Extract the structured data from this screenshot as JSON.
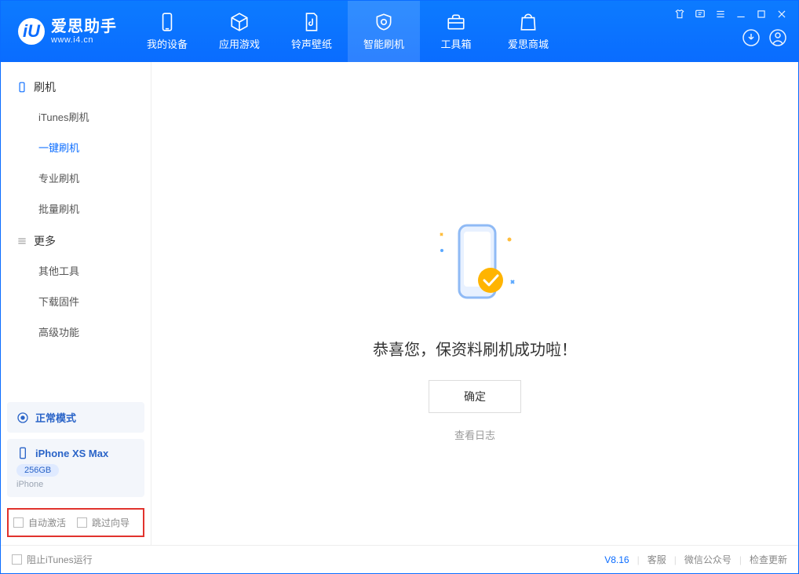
{
  "brand": {
    "title": "爱思助手",
    "subtitle": "www.i4.cn"
  },
  "tabs": [
    {
      "label": "我的设备"
    },
    {
      "label": "应用游戏"
    },
    {
      "label": "铃声壁纸"
    },
    {
      "label": "智能刷机"
    },
    {
      "label": "工具箱"
    },
    {
      "label": "爱思商城"
    }
  ],
  "sidebar": {
    "group1": {
      "title": "刷机",
      "items": [
        {
          "label": "iTunes刷机"
        },
        {
          "label": "一键刷机"
        },
        {
          "label": "专业刷机"
        },
        {
          "label": "批量刷机"
        }
      ]
    },
    "group2": {
      "title": "更多",
      "items": [
        {
          "label": "其他工具"
        },
        {
          "label": "下载固件"
        },
        {
          "label": "高级功能"
        }
      ]
    },
    "mode_box": {
      "label": "正常模式"
    },
    "device_box": {
      "name": "iPhone XS Max",
      "storage": "256GB",
      "type": "iPhone"
    },
    "checks": {
      "auto_activate": "自动激活",
      "skip_guide": "跳过向导"
    }
  },
  "main": {
    "success_message": "恭喜您，保资料刷机成功啦！",
    "ok_button": "确定",
    "view_log": "查看日志"
  },
  "footer": {
    "block_itunes": "阻止iTunes运行",
    "version": "V8.16",
    "links": {
      "cs": "客服",
      "wechat": "微信公众号",
      "update": "检查更新"
    }
  }
}
